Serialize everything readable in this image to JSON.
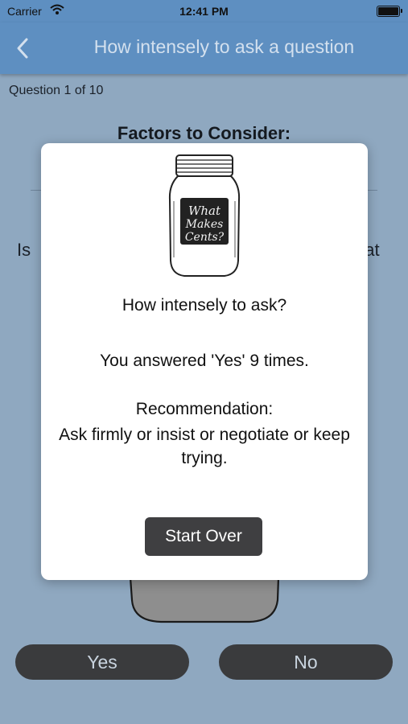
{
  "status_bar": {
    "carrier": "Carrier",
    "time": "12:41 PM"
  },
  "nav": {
    "title": "How intensely to ask a question",
    "back_icon": "chevron-left-icon"
  },
  "background": {
    "progress": "Question 1 of 10",
    "factors_title": "Factors to Consider:",
    "question_fragment_left": "Is",
    "question_fragment_right": "hat"
  },
  "answers": {
    "yes_label": "Yes",
    "no_label": "No"
  },
  "modal": {
    "logo_text": [
      "What",
      "Makes",
      "Cents?"
    ],
    "heading": "How intensely to ask?",
    "answered": "You answered 'Yes' 9 times.",
    "rec_label": "Recommendation:",
    "rec_text": "Ask firmly or insist or negotiate or keep trying.",
    "start_over_label": "Start Over"
  },
  "colors": {
    "nav_bar": "#5e8fc1",
    "page_background": "#8fa8c0",
    "button_dark": "#3a3b3d"
  }
}
